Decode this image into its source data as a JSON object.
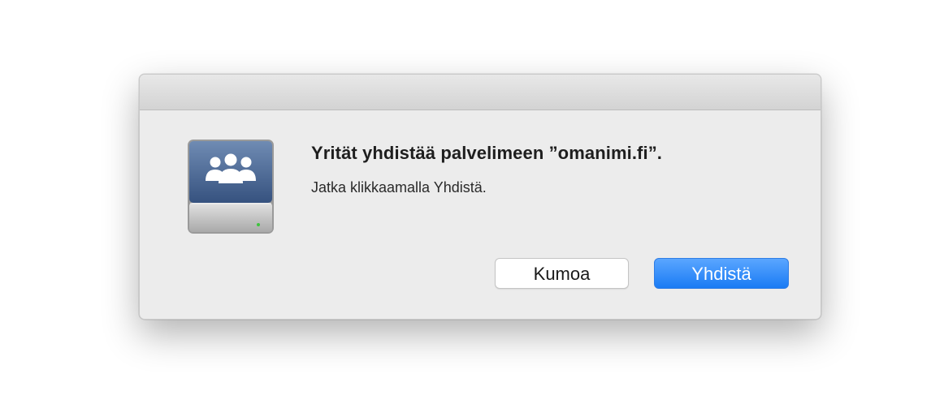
{
  "dialog": {
    "title": "Yrität yhdistää palvelimeen ”omanimi.fi”.",
    "message": "Jatka klikkaamalla Yhdistä.",
    "buttons": {
      "cancel_label": "Kumoa",
      "connect_label": "Yhdistä"
    },
    "icon": "shared-server-drive-icon"
  },
  "colors": {
    "primary_button": "#1a7bf4",
    "drive_face": "#3f5d8c",
    "drive_led": "#3ec43e"
  }
}
